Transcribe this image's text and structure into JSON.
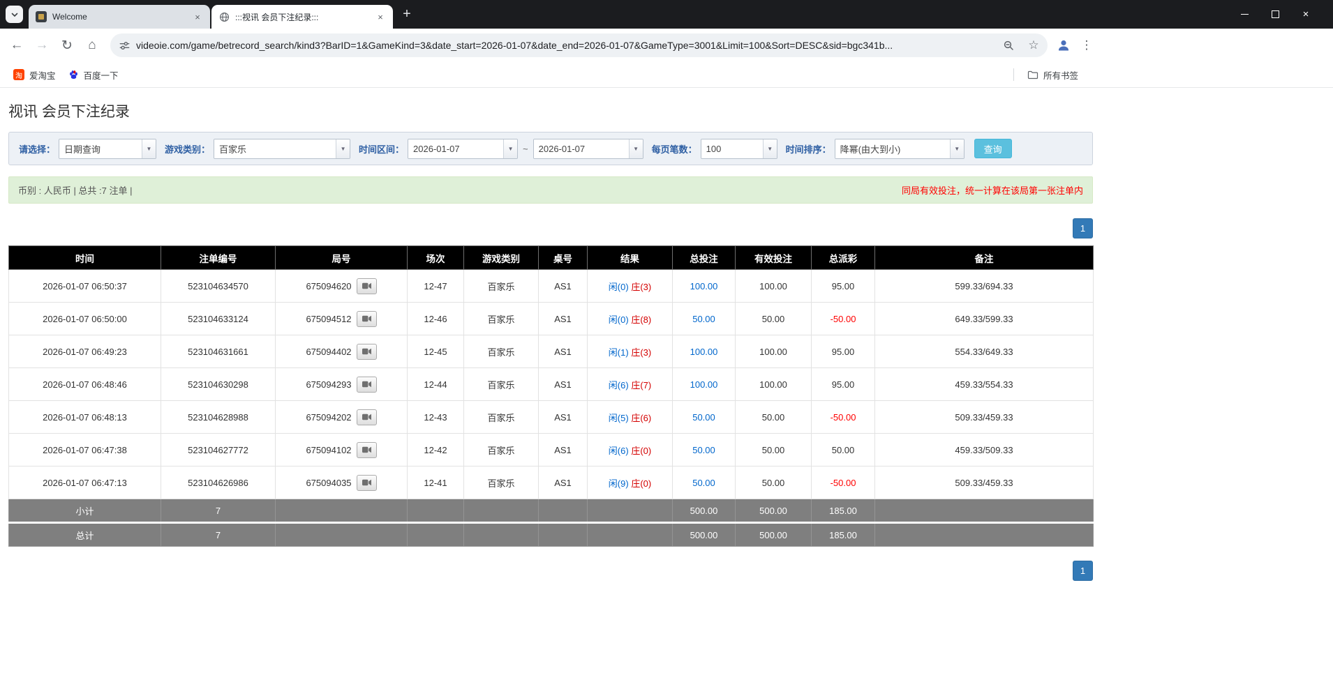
{
  "icons": {
    "back": "←",
    "forward": "→",
    "reload": "↻",
    "home": "⌂",
    "menu_kebab": "⋮",
    "bookmark_star": "☆",
    "tab_close": "×",
    "window_close": "×",
    "new_tab": "+",
    "combo_arrow": "▼"
  },
  "colors": {
    "filter_label_blue": "#2e5fa3",
    "search_button_blue": "#5bc0de",
    "notice_bg_green": "#dff0d8",
    "notice_warning_red": "#ff0000",
    "pagination_blue": "#337ab7",
    "table_header_bg": "#000000",
    "summary_row_bg": "#7f7f7f",
    "player_result_blue": "#0066cc",
    "banker_result_red": "#d40000",
    "bet_link_blue": "#0066cc",
    "negative_red": "#ff0000"
  },
  "browser": {
    "tabs": [
      {
        "title": "Welcome"
      },
      {
        "title": ":::视讯 会员下注纪录:::"
      }
    ],
    "url": "videoie.com/game/betrecord_search/kind3?BarID=1&GameKind=3&date_start=2026-01-07&date_end=2026-01-07&GameType=3001&Limit=100&Sort=DESC&sid=bgc341b...",
    "bookmarks_bar": {
      "items": [
        {
          "label": "爱淘宝",
          "icon_text": "淘"
        },
        {
          "label": "百度一下"
        }
      ],
      "all_bookmarks": "所有书签"
    }
  },
  "page": {
    "title": "视讯 会员下注纪录",
    "filters": {
      "select_label": "请选择：",
      "select_value": "日期查询",
      "game_type_label": "游戏类别：",
      "game_type_value": "百家乐",
      "date_range_label": "时间区间：",
      "date_start": "2026-01-07",
      "date_separator": "~",
      "date_end": "2026-01-07",
      "page_size_label": "每页笔数：",
      "page_size_value": "100",
      "sort_label": "时间排序：",
      "sort_value": "降幂(由大到小)",
      "search_button": "查询"
    },
    "notice": {
      "left": "币别 : 人民币 | 总共 :7 注单 |",
      "right": "同局有效投注，统一计算在该局第一张注单内"
    },
    "pagination": {
      "current_page": "1"
    },
    "table": {
      "headers": [
        "时间",
        "注单编号",
        "局号",
        "场次",
        "游戏类别",
        "桌号",
        "结果",
        "总投注",
        "有效投注",
        "总派彩",
        "备注"
      ],
      "rows": [
        {
          "time": "2026-01-07 06:50:37",
          "bet_id": "523104634570",
          "round_id": "675094620",
          "session": "12-47",
          "game_type": "百家乐",
          "table_no": "AS1",
          "result_player": "闲(0)",
          "result_banker": "庄(3)",
          "total_bet": "100.00",
          "valid_bet": "100.00",
          "payout": "95.00",
          "remark": "599.33/694.33"
        },
        {
          "time": "2026-01-07 06:50:00",
          "bet_id": "523104633124",
          "round_id": "675094512",
          "session": "12-46",
          "game_type": "百家乐",
          "table_no": "AS1",
          "result_player": "闲(0)",
          "result_banker": "庄(8)",
          "total_bet": "50.00",
          "valid_bet": "50.00",
          "payout": "-50.00",
          "remark": "649.33/599.33"
        },
        {
          "time": "2026-01-07 06:49:23",
          "bet_id": "523104631661",
          "round_id": "675094402",
          "session": "12-45",
          "game_type": "百家乐",
          "table_no": "AS1",
          "result_player": "闲(1)",
          "result_banker": "庄(3)",
          "total_bet": "100.00",
          "valid_bet": "100.00",
          "payout": "95.00",
          "remark": "554.33/649.33"
        },
        {
          "time": "2026-01-07 06:48:46",
          "bet_id": "523104630298",
          "round_id": "675094293",
          "session": "12-44",
          "game_type": "百家乐",
          "table_no": "AS1",
          "result_player": "闲(6)",
          "result_banker": "庄(7)",
          "total_bet": "100.00",
          "valid_bet": "100.00",
          "payout": "95.00",
          "remark": "459.33/554.33"
        },
        {
          "time": "2026-01-07 06:48:13",
          "bet_id": "523104628988",
          "round_id": "675094202",
          "session": "12-43",
          "game_type": "百家乐",
          "table_no": "AS1",
          "result_player": "闲(5)",
          "result_banker": "庄(6)",
          "total_bet": "50.00",
          "valid_bet": "50.00",
          "payout": "-50.00",
          "remark": "509.33/459.33"
        },
        {
          "time": "2026-01-07 06:47:38",
          "bet_id": "523104627772",
          "round_id": "675094102",
          "session": "12-42",
          "game_type": "百家乐",
          "table_no": "AS1",
          "result_player": "闲(6)",
          "result_banker": "庄(0)",
          "total_bet": "50.00",
          "valid_bet": "50.00",
          "payout": "50.00",
          "remark": "459.33/509.33"
        },
        {
          "time": "2026-01-07 06:47:13",
          "bet_id": "523104626986",
          "round_id": "675094035",
          "session": "12-41",
          "game_type": "百家乐",
          "table_no": "AS1",
          "result_player": "闲(9)",
          "result_banker": "庄(0)",
          "total_bet": "50.00",
          "valid_bet": "50.00",
          "payout": "-50.00",
          "remark": "509.33/459.33"
        }
      ],
      "subtotal": {
        "label": "小计",
        "count": "7",
        "total_bet": "500.00",
        "valid_bet": "500.00",
        "payout": "185.00"
      },
      "total": {
        "label": "总计",
        "count": "7",
        "total_bet": "500.00",
        "valid_bet": "500.00",
        "payout": "185.00"
      }
    }
  }
}
